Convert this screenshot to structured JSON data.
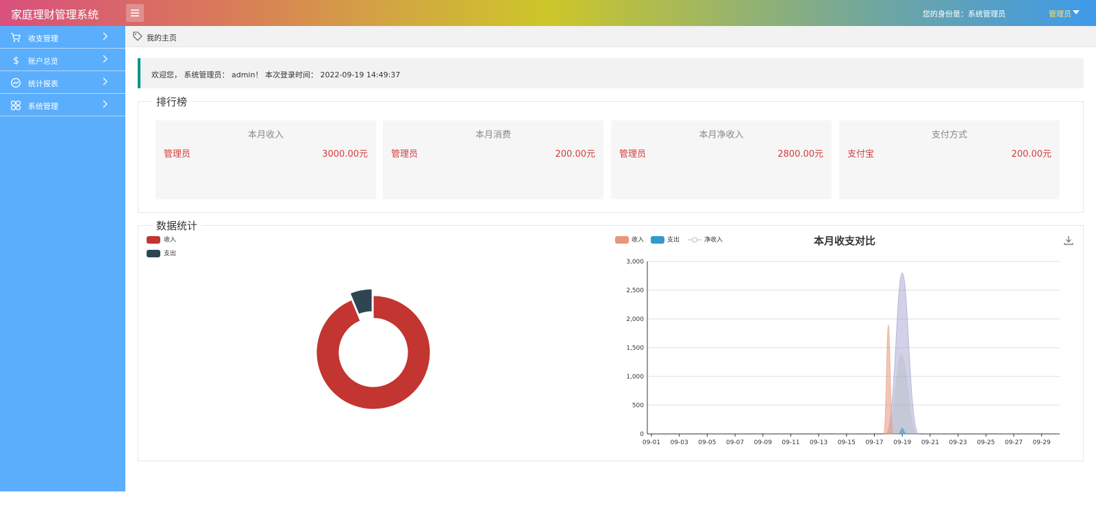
{
  "header": {
    "app_title": "家庭理财管理系统",
    "identity_label": "您的身份是：系统管理员",
    "user_menu_label": "管理员"
  },
  "sidebar": {
    "items": [
      {
        "label": "收支管理",
        "icon": "cart-icon"
      },
      {
        "label": "账户总览",
        "icon": "dollar-icon"
      },
      {
        "label": "统计报表",
        "icon": "trend-icon"
      },
      {
        "label": "系统管理",
        "icon": "grid-icon"
      }
    ]
  },
  "breadcrumb": {
    "label": "我的主页"
  },
  "welcome": {
    "text": "欢迎您， 系统管理员： admin！ 本次登录时间： 2022-09-19 14:49:37"
  },
  "ranking": {
    "legend": "排行榜",
    "cards": [
      {
        "title": "本月收入",
        "name": "管理员",
        "value": "3000.00元"
      },
      {
        "title": "本月消费",
        "name": "管理员",
        "value": "200.00元"
      },
      {
        "title": "本月净收入",
        "name": "管理员",
        "value": "2800.00元"
      },
      {
        "title": "支付方式",
        "name": "支付宝",
        "value": "200.00元"
      }
    ]
  },
  "stats": {
    "legend": "数据统计"
  },
  "colors": {
    "income_pie": "#c23531",
    "expense_pie": "#2f4554",
    "income_line": "#e9967a",
    "expense_line": "#3399cc",
    "net_line": "#9999cc",
    "accent_border": "#009688",
    "sidebar_bg": "#5baefc",
    "value_red": "#d33b3b"
  },
  "chart_data": [
    {
      "type": "pie",
      "style": "donut",
      "categories": [
        "收入",
        "支出"
      ],
      "values": [
        3000,
        200
      ],
      "legend_placement": "top-left"
    },
    {
      "type": "area",
      "title": "本月收支对比",
      "x": [
        "09-01",
        "09-02",
        "09-03",
        "09-04",
        "09-05",
        "09-06",
        "09-07",
        "09-08",
        "09-09",
        "09-10",
        "09-11",
        "09-12",
        "09-13",
        "09-14",
        "09-15",
        "09-16",
        "09-17",
        "09-18",
        "09-19",
        "09-20",
        "09-21",
        "09-22",
        "09-23",
        "09-24",
        "09-25",
        "09-26",
        "09-27",
        "09-28",
        "09-29",
        "09-30"
      ],
      "x_tick_labels": [
        "09-01",
        "09-03",
        "09-05",
        "09-07",
        "09-09",
        "09-11",
        "09-13",
        "09-15",
        "09-17",
        "09-19",
        "09-21",
        "09-23",
        "09-25",
        "09-27",
        "09-29"
      ],
      "ylim": [
        0,
        3000
      ],
      "y_tick_labels": [
        "0",
        "500",
        "1,000",
        "1,500",
        "2,000",
        "2,500",
        "3,000"
      ],
      "grid": true,
      "legend_placement": "top-left",
      "series": [
        {
          "name": "收入",
          "values": [
            0,
            0,
            0,
            0,
            0,
            0,
            0,
            0,
            0,
            0,
            0,
            0,
            0,
            0,
            0,
            0,
            0,
            1900,
            0,
            0,
            0,
            0,
            0,
            0,
            0,
            0,
            0,
            0,
            0,
            0
          ]
        },
        {
          "name": "支出",
          "values": [
            0,
            0,
            0,
            0,
            0,
            0,
            0,
            0,
            0,
            0,
            0,
            0,
            0,
            0,
            0,
            0,
            0,
            0,
            100,
            0,
            0,
            0,
            0,
            0,
            0,
            0,
            0,
            0,
            0,
            0
          ]
        },
        {
          "name": "净收入",
          "values": [
            0,
            0,
            0,
            0,
            0,
            0,
            0,
            0,
            0,
            0,
            0,
            0,
            0,
            0,
            0,
            0,
            0,
            0,
            2800,
            0,
            0,
            0,
            0,
            0,
            0,
            0,
            0,
            0,
            0,
            0
          ]
        }
      ]
    }
  ]
}
